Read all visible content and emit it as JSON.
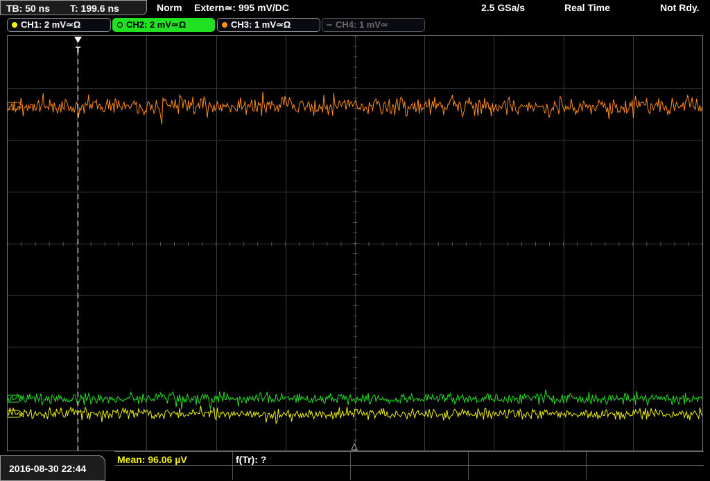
{
  "status": {
    "timebase": "TB: 50 ns",
    "trigger_time": "T: 199.6 ns",
    "mode": "Norm",
    "trigger_source": "Extern≃: 995 mV",
    "trigger_slope": "/DC",
    "sample_rate": "2.5 GSa/s",
    "acq_mode": "Real Time",
    "state": "Not Rdy."
  },
  "channels": [
    {
      "label": "CH1: 2 mV≃Ω",
      "color": "#f2f20a",
      "active": false,
      "enabled": true
    },
    {
      "label": "CH2: 2 mV≃Ω",
      "color": "#22e022",
      "active": true,
      "enabled": true
    },
    {
      "label": "CH3: 1 mV≃Ω",
      "color": "#ff8c1a",
      "active": false,
      "enabled": true
    },
    {
      "label": "CH4: 1 mV≃",
      "color": "#6a6a6a",
      "active": false,
      "enabled": false
    }
  ],
  "bottom": {
    "datetime": "2016-08-30 22:44",
    "mean": "Mean: 96.06 µV",
    "freq": "f(Tr): ?"
  },
  "colors": {
    "ch1": "#f2f20a",
    "ch2": "#22e022",
    "ch3": "#ff8c1a",
    "grid": "#3a3a3a",
    "trigger_marker": "#ffffff"
  },
  "markers": {
    "trigger": "T",
    "ch_ref": "▷"
  }
}
